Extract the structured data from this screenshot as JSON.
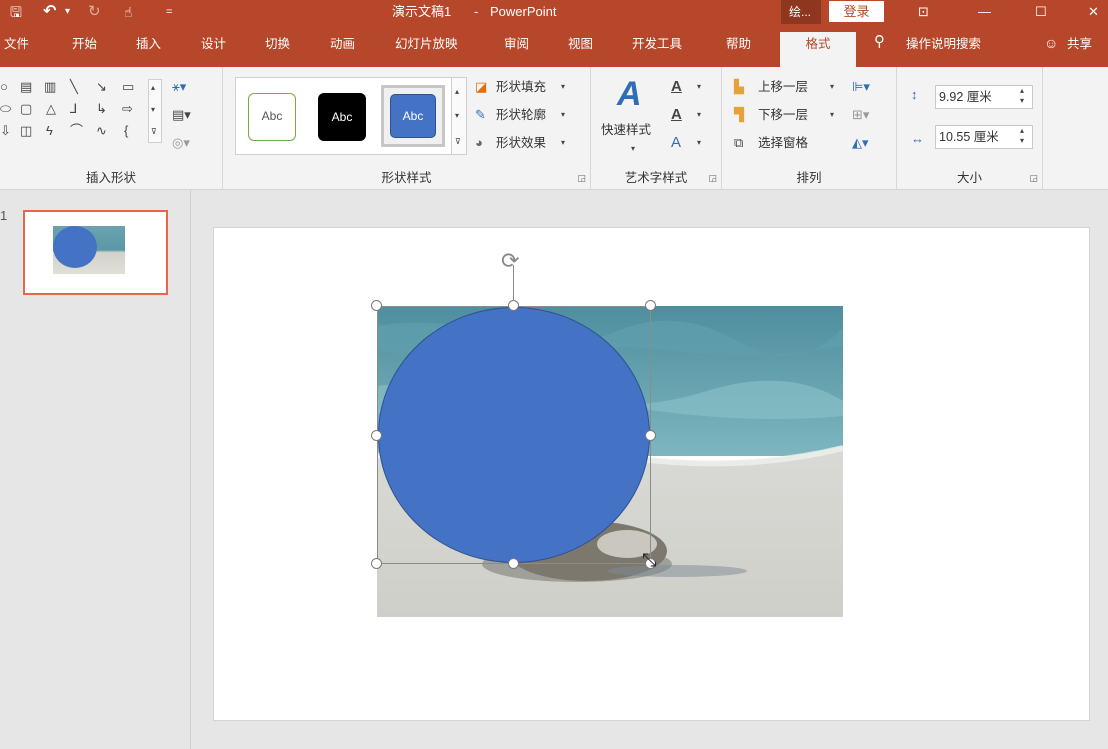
{
  "qat": {
    "save_icon": "save-icon",
    "undo_icon": "undo-icon",
    "undo_dropdown": "▾",
    "redo_icon": "redo-icon",
    "touch_icon": "touch-mode-icon",
    "customize": "="
  },
  "title": {
    "doc": "演示文稿1",
    "sep": "-",
    "app": "PowerPoint"
  },
  "context_tab": "绘...",
  "login": "登录",
  "window": {
    "ribbon_display": "ribbon-display-icon",
    "minimize": "—",
    "maximize": "☐",
    "close": "✕"
  },
  "tabs": [
    {
      "label": "文件"
    },
    {
      "label": "开始"
    },
    {
      "label": "插入"
    },
    {
      "label": "设计"
    },
    {
      "label": "切换"
    },
    {
      "label": "动画"
    },
    {
      "label": "幻灯片放映"
    },
    {
      "label": "审阅"
    },
    {
      "label": "视图"
    },
    {
      "label": "开发工具"
    },
    {
      "label": "帮助"
    },
    {
      "label": "格式"
    }
  ],
  "tell_me": "操作说明搜索",
  "share": "共享",
  "ribbon": {
    "insert_shapes": {
      "label": "插入形状"
    },
    "shape_styles": {
      "label": "形状样式",
      "previews": [
        "Abc",
        "Abc",
        "Abc"
      ],
      "fill": "形状填充",
      "outline": "形状轮廓",
      "effects": "形状效果"
    },
    "wordart": {
      "label": "艺术字样式",
      "quick": "快速样式"
    },
    "arrange": {
      "label": "排列",
      "forward": "上移一层",
      "backward": "下移一层",
      "pane": "选择窗格"
    },
    "size": {
      "label": "大小",
      "height": "9.92 厘米",
      "width": "10.55 厘米"
    }
  },
  "slides": [
    {
      "number": "1"
    }
  ],
  "colors": {
    "accent": "#b7472a",
    "shape_fill": "#4472c4",
    "thumb_border": "#e4674c"
  }
}
